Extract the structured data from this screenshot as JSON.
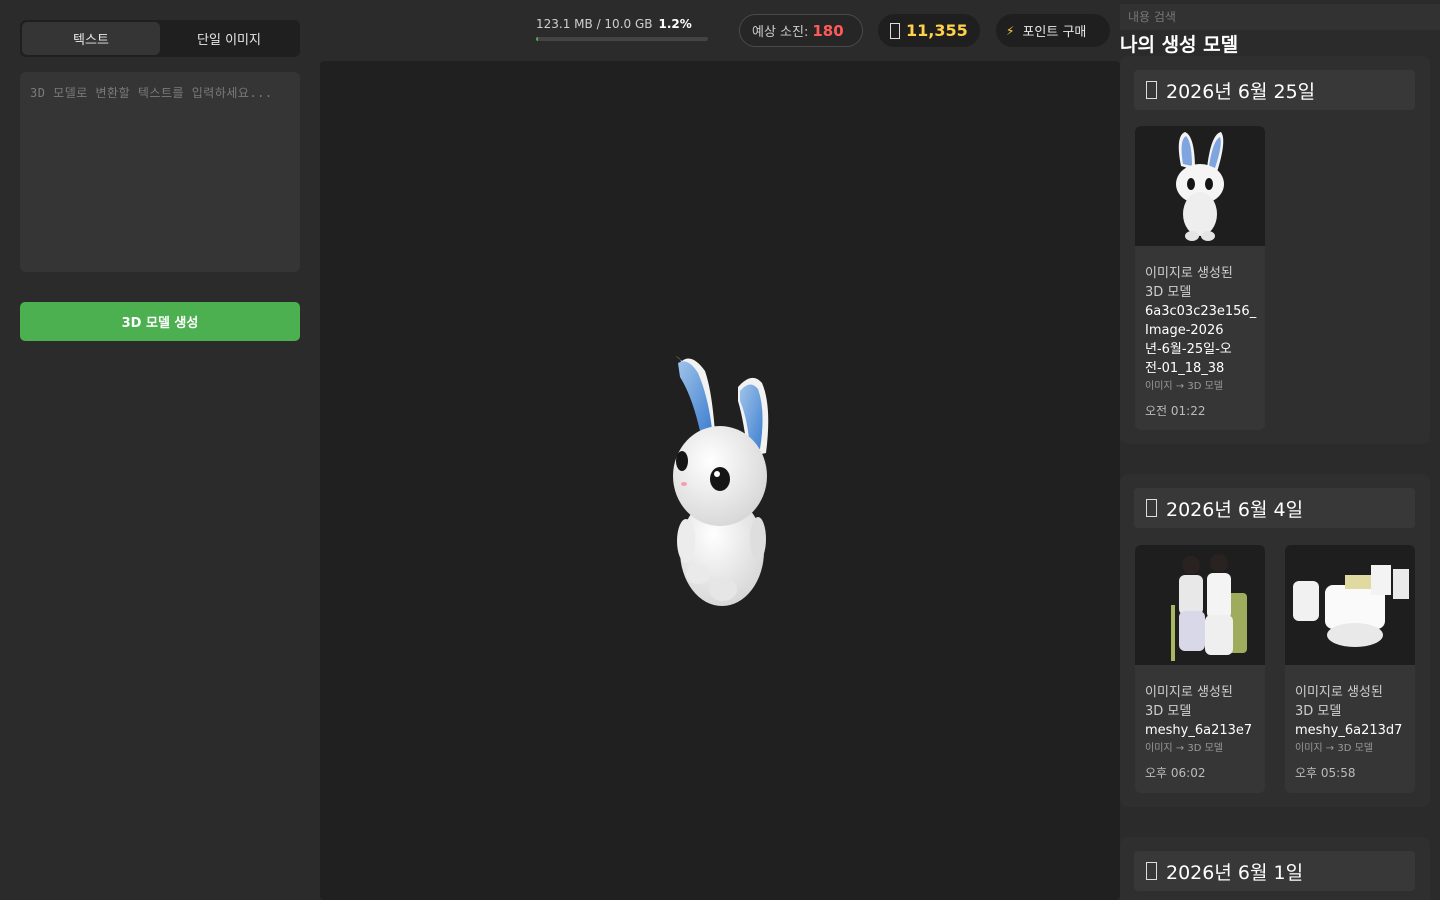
{
  "left": {
    "tabs": [
      {
        "label": "텍스트",
        "active": true
      },
      {
        "label": "단일 이미지",
        "active": false
      }
    ],
    "prompt_placeholder": "3D 모델로 변환할 텍스트를 입력하세요...",
    "generate_label": "3D 모델 생성"
  },
  "topbar": {
    "storage_text": "123.1 MB / 10.0 GB",
    "storage_percent_text": "1.2%",
    "storage_fraction": 0.012,
    "cost_label": "예상 소진:",
    "cost_value": "180",
    "points_value": "11,355",
    "buy_label": "포인트 구매",
    "bolt_icon": "⚡"
  },
  "right": {
    "search_placeholder": "내용 검색",
    "title": "나의 생성 모델",
    "groups": [
      {
        "date": "2026년 6월 25일",
        "cards": [
          {
            "line1": "이미지로 생성된",
            "line2": "3D 모델",
            "name": "6a3c03c23e156_\nImage-2026\n년-6월-25일-오\n전-01_18_38",
            "tag": "이미지 → 3D 모델",
            "time": "오전 01:22",
            "thumb": "bunny"
          }
        ]
      },
      {
        "date": "2026년 6월 4일",
        "cards": [
          {
            "line1": "이미지로 생성된",
            "line2": "3D 모델",
            "name": "meshy_6a213e7",
            "tag": "이미지 → 3D 모델",
            "time": "오후 06:02",
            "thumb": "people"
          },
          {
            "line1": "이미지로 생성된",
            "line2": "3D 모델",
            "name": "meshy_6a213d7",
            "tag": "이미지 → 3D 모델",
            "time": "오후 05:58",
            "thumb": "products"
          }
        ]
      },
      {
        "date": "2026년 6월 1일",
        "cards": []
      }
    ]
  },
  "colors": {
    "accent_green": "#4caf50",
    "cost_red": "#ff5a5a",
    "points_yellow": "#ffd24a"
  }
}
